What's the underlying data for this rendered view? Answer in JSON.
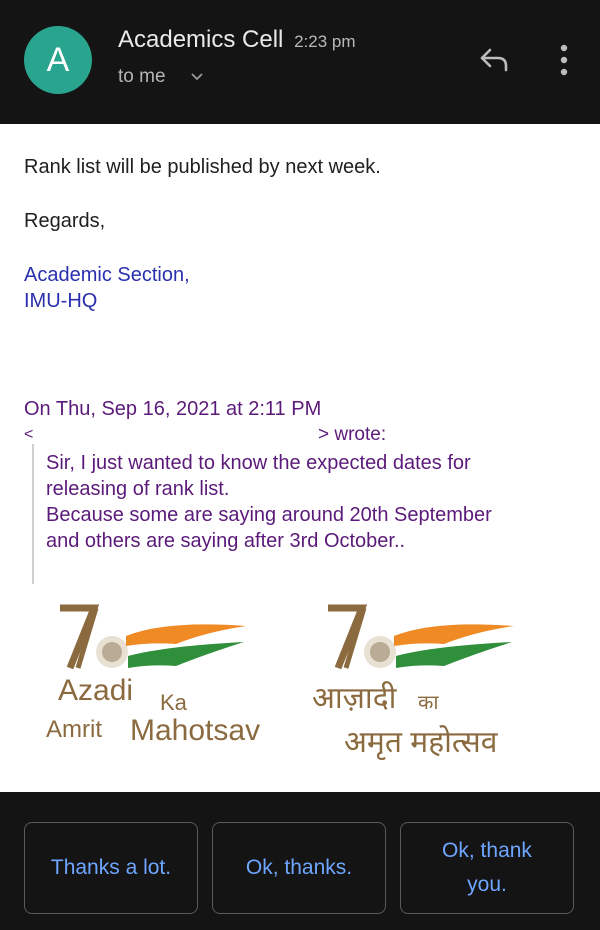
{
  "header": {
    "avatar_letter": "A",
    "sender": "Academics Cell",
    "time": "2:23 pm",
    "recipient": "to me",
    "icons": [
      "chevron-down-icon",
      "reply-icon",
      "more-vertical-icon"
    ],
    "avatar_color": "#28a48f"
  },
  "message": {
    "body": "Rank list will be published by next week.",
    "regards": "Regards,",
    "signature_line1": "Academic Section,",
    "signature_line2": "IMU-HQ",
    "quote_header": "On Thu, Sep 16, 2021 at 2:11 PM",
    "quote_from_open": "<",
    "quote_from_close": "> wrote:",
    "quoted_lines": [
      "Sir, I just wanted to know the expected dates for",
      "releasing of rank list.",
      "Because some are saying around 20th September",
      "and others are saying after 3rd October.."
    ]
  },
  "logos": {
    "english": {
      "word1": "Azadi",
      "word2": "Ka",
      "word3": "Amrit",
      "word4": "Mahotsav"
    },
    "hindi": {
      "word1": "आज़ादी",
      "word2": "का",
      "word3": "अमृत महोत्सव"
    },
    "number": "75",
    "colors": {
      "saffron": "#f08a24",
      "green": "#2f8f3a",
      "brown": "#8a6a3e"
    }
  },
  "smart_replies": [
    "Thanks a lot.",
    "Ok, thanks.",
    "Ok, thank you."
  ]
}
